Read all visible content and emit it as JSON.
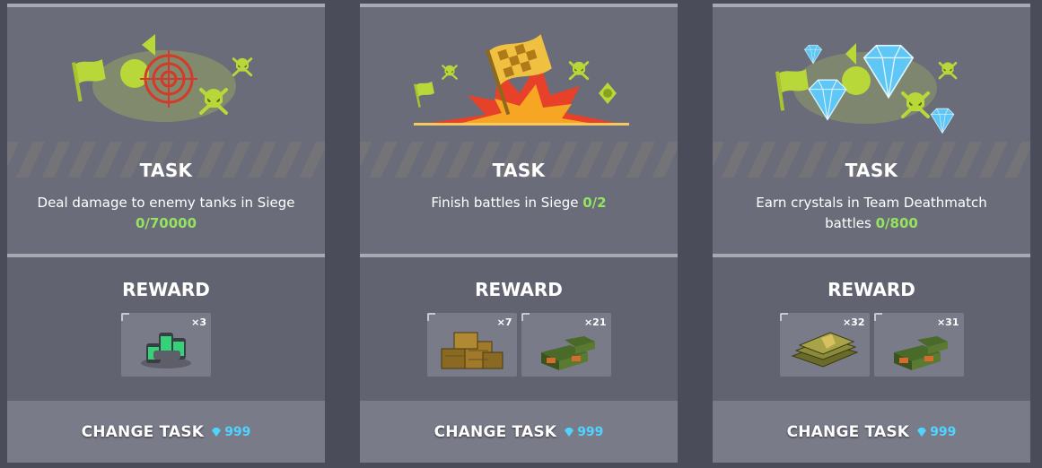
{
  "colors": {
    "page_bg": "#4b4c5a",
    "card_bg": "#6b6c7a",
    "progress": "#94e361",
    "crystal": "#4fd3ff"
  },
  "cards": [
    {
      "art_icon": "target-skull-art",
      "task_title": "TASK",
      "task_desc": "Deal damage to enemy tanks in Siege",
      "task_progress": "0/70000",
      "reward_title": "REWARD",
      "rewards": [
        {
          "icon": "batteries-icon",
          "count": "×3"
        }
      ],
      "change_label": "CHANGE TASK",
      "price": "999"
    },
    {
      "art_icon": "checkered-flag-explosion-art",
      "task_title": "TASK",
      "task_desc": "Finish battles in Siege",
      "task_progress": "0/2",
      "reward_title": "REWARD",
      "rewards": [
        {
          "icon": "supply-crates-icon",
          "count": "×7"
        },
        {
          "icon": "ammo-boxes-icon",
          "count": "×21"
        }
      ],
      "change_label": "CHANGE TASK",
      "price": "999"
    },
    {
      "art_icon": "crystals-skull-art",
      "task_title": "TASK",
      "task_desc": "Earn crystals in Team Deathmatch battles",
      "task_progress": "0/800",
      "reward_title": "REWARD",
      "rewards": [
        {
          "icon": "gold-plates-icon",
          "count": "×32"
        },
        {
          "icon": "ammo-boxes-icon",
          "count": "×31"
        }
      ],
      "change_label": "CHANGE TASK",
      "price": "999"
    }
  ]
}
